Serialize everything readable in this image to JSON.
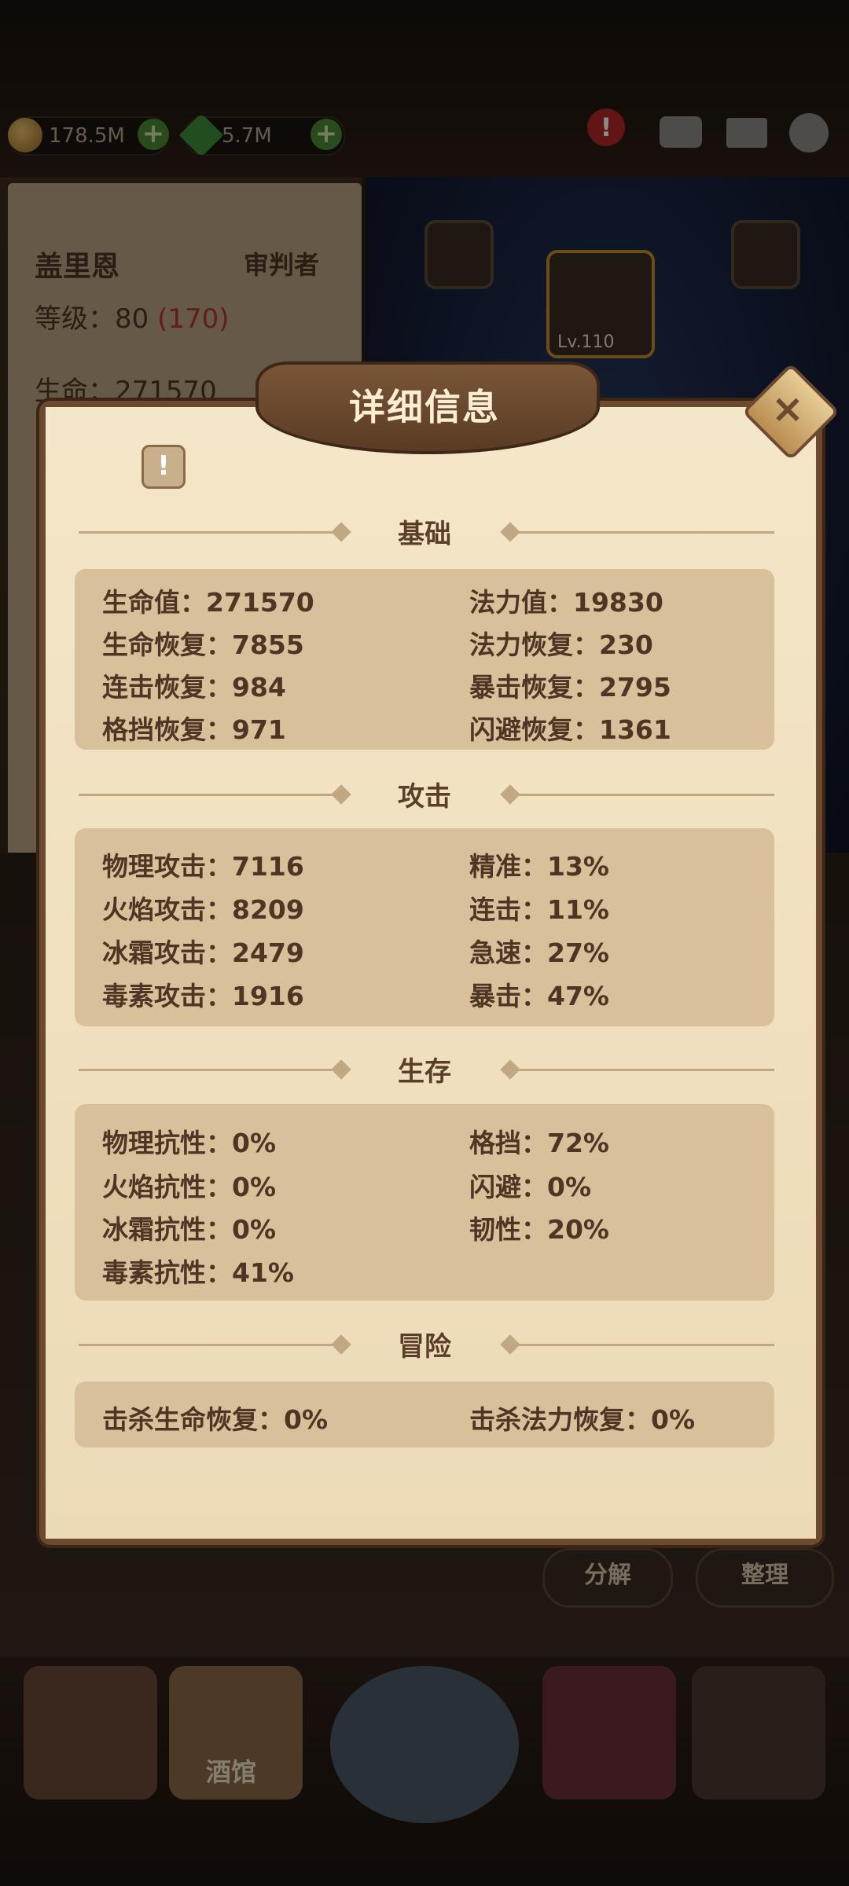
{
  "resources": {
    "gold": "178.5M",
    "gems": "5.7M"
  },
  "hero": {
    "name": "盖里恩",
    "class": "审判者",
    "level_label": "等级：80",
    "level_cap": "(170)",
    "hp_partial": "生命：271570"
  },
  "slot_level": "Lv.110",
  "dialog": {
    "title": "详细信息",
    "info_icon": "!",
    "close_icon": "×",
    "sections": {
      "basic": {
        "title": "基础",
        "rows": [
          {
            "left": "生命值：271570",
            "right": "法力值：19830"
          },
          {
            "left": "生命恢复：7855",
            "right": "法力恢复：230"
          },
          {
            "left": "连击恢复：984",
            "right": "暴击恢复：2795"
          },
          {
            "left": "格挡恢复：971",
            "right": "闪避恢复：1361"
          }
        ]
      },
      "attack": {
        "title": "攻击",
        "rows": [
          {
            "left": "物理攻击：7116",
            "right": "精准：13%"
          },
          {
            "left": "火焰攻击：8209",
            "right": "连击：11%"
          },
          {
            "left": "冰霜攻击：2479",
            "right": "急速：27%"
          },
          {
            "left": "毒素攻击：1916",
            "right": "暴击：47%"
          }
        ]
      },
      "survival": {
        "title": "生存",
        "rows": [
          {
            "left": "物理抗性：0%",
            "right": "格挡：72%"
          },
          {
            "left": "火焰抗性：0%",
            "right": "闪避：0%"
          },
          {
            "left": "冰霜抗性：0%",
            "right": "韧性：20%"
          },
          {
            "left": "毒素抗性：41%",
            "right": ""
          }
        ]
      },
      "adventure": {
        "title": "冒险",
        "rows": [
          {
            "left": "击杀生命恢复：0%",
            "right": "击杀法力恢复：0%"
          }
        ]
      }
    }
  },
  "buttons": {
    "decompose": "分解",
    "organize": "整理"
  },
  "nav": {
    "tavern": "酒馆"
  },
  "colors": {
    "panel": "#f1e1c2",
    "box": "#d7c09a",
    "text": "#4e3625",
    "accent_red": "#b3362b"
  }
}
